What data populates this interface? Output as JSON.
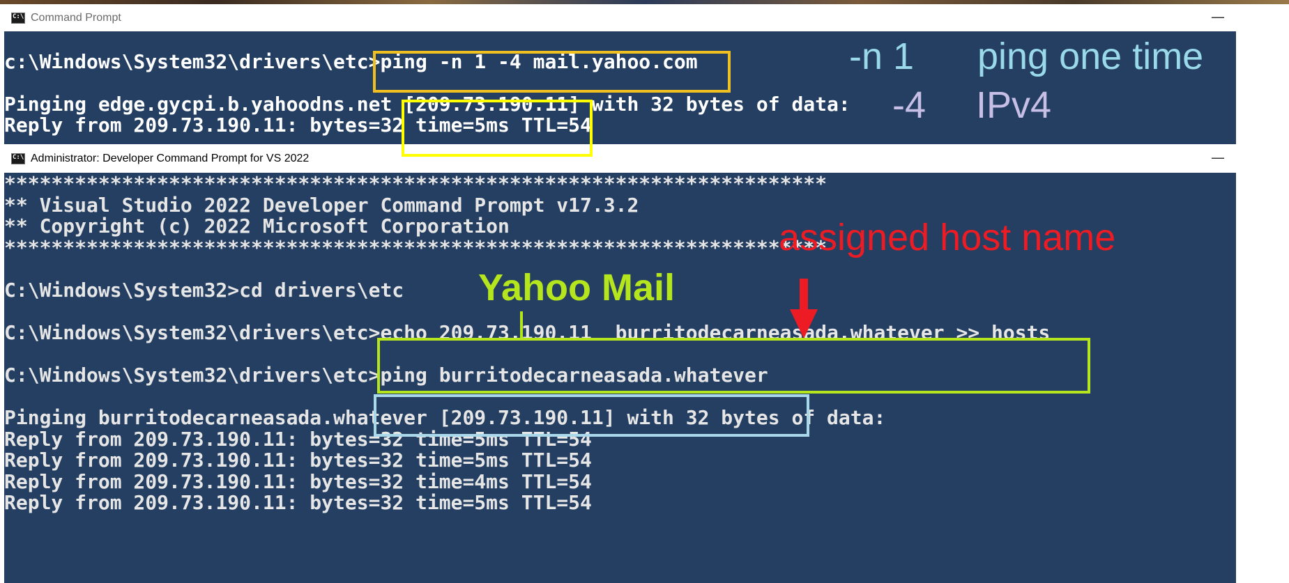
{
  "window1": {
    "title": "Command Prompt",
    "minimize": "—",
    "lines": [
      "c:\\Windows\\System32\\drivers\\etc>ping -n 1 -4 mail.yahoo.com",
      "Pinging edge.gycpi.b.yahoodns.net [209.73.190.11] with 32 bytes of data:",
      "Reply from 209.73.190.11: bytes=32 time=5ms TTL=54"
    ]
  },
  "window2": {
    "title": "Administrator: Developer Command Prompt for VS 2022",
    "minimize": "—",
    "lines": [
      "**********************************************************************",
      "** Visual Studio 2022 Developer Command Prompt v17.3.2",
      "** Copyright (c) 2022 Microsoft Corporation",
      "**********************************************************************",
      "C:\\Windows\\System32>cd drivers\\etc",
      "C:\\Windows\\System32\\drivers\\etc>echo 209.73.190.11  burritodecarneasada.whatever >> hosts",
      "C:\\Windows\\System32\\drivers\\etc>ping burritodecarneasada.whatever",
      "Pinging burritodecarneasada.whatever [209.73.190.11] with 32 bytes of data:",
      "Reply from 209.73.190.11: bytes=32 time=5ms TTL=54",
      "Reply from 209.73.190.11: bytes=32 time=5ms TTL=54",
      "Reply from 209.73.190.11: bytes=32 time=4ms TTL=54",
      "Reply from 209.73.190.11: bytes=32 time=5ms TTL=54"
    ]
  },
  "annotations": {
    "flag_n": "-n  1",
    "flag_n_desc": "ping one time",
    "flag_4": "-4",
    "flag_4_desc": "IPv4",
    "assigned_host_name": "assigned host name",
    "yahoo_mail": "Yahoo Mail"
  },
  "colors": {
    "console_bg": "#243f62",
    "box_yellow_orange": "#f0c020",
    "box_yellow": "#ffff00",
    "box_green": "#b5e61d",
    "box_light_blue": "#a8d8ea",
    "annotation_blue": "#99d9ea",
    "annotation_lavender": "#c8bfe7",
    "annotation_red": "#ed1c24",
    "annotation_green": "#b5e61d"
  },
  "icons": {
    "console_icon": "command-prompt-icon",
    "minimize_icon": "minimize-icon",
    "arrow": "red-down-arrow"
  }
}
